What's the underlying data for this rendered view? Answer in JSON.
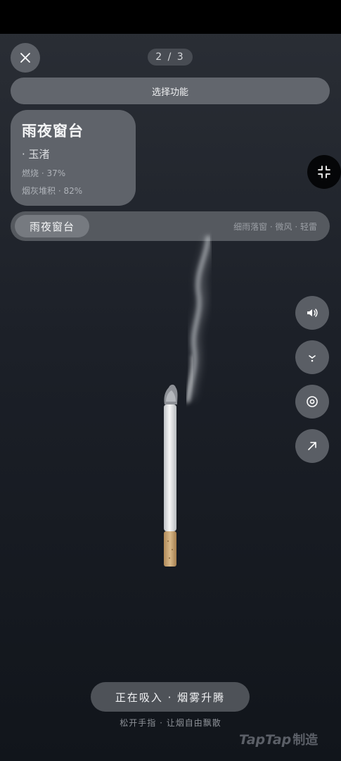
{
  "page_indicator": "2 / 3",
  "function_bar": {
    "label": "选择功能"
  },
  "info_card": {
    "title": "雨夜窗台",
    "subtitle": "· 玉渚",
    "burn": "燃烧 · 37%",
    "ash": "烟灰堆积 · 82%"
  },
  "scene_bar": {
    "selected": "雨夜窗台",
    "tags": "细雨落窗 · 微风 · 轻雷"
  },
  "status": {
    "main": "正在吸入 · 烟雾升腾",
    "hint": "松开手指 · 让烟自由飘散"
  },
  "watermark": {
    "brand": "TapTap",
    "suffix": "制造"
  },
  "icons": {
    "close": "close-icon",
    "collapse": "collapse-icon",
    "sound": "speaker-icon",
    "ash": "ash-icon",
    "target": "target-icon",
    "share": "arrow-up-right-icon"
  },
  "colors": {
    "background": "#1c2028",
    "filter": "#e6e0d8",
    "cigarette": "#f2f2f2"
  }
}
